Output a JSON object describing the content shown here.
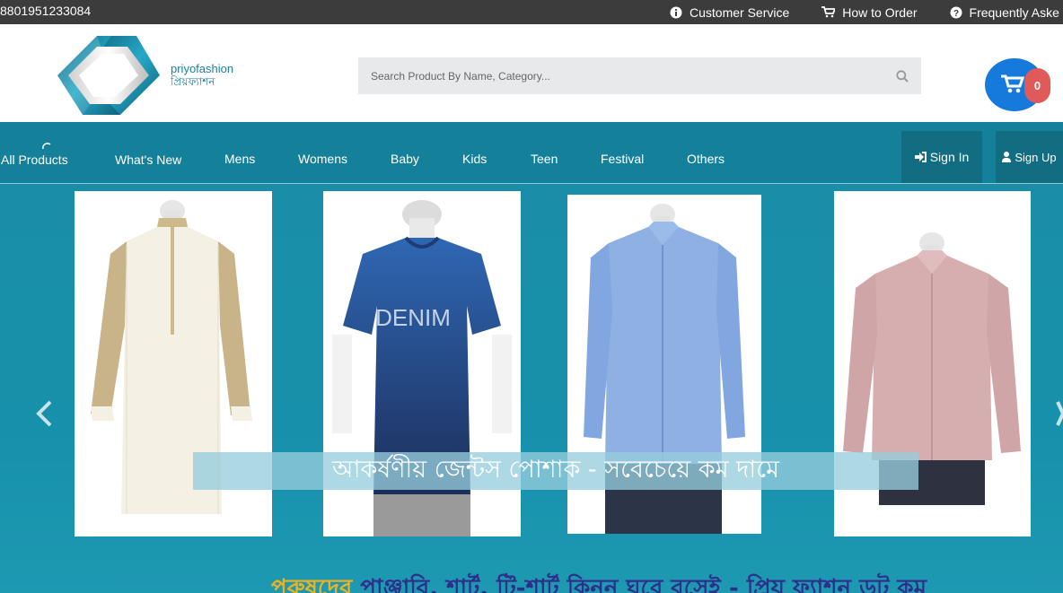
{
  "topbar": {
    "phone": "8801951233084",
    "links": [
      {
        "label": "Customer Service",
        "icon": "info-circle-icon"
      },
      {
        "label": "How to Order",
        "icon": "cart-icon"
      },
      {
        "label": "Frequently Aske",
        "icon": "question-circle-icon"
      }
    ]
  },
  "brand": {
    "name_en": "priyofashion",
    "name_bn": "প্রিয়ফ্যাশন",
    "logo_color": "#1a7fa0"
  },
  "search": {
    "placeholder": "Search Product By Name, Category...",
    "icon": "search-icon"
  },
  "cart": {
    "count": "0",
    "icon": "shopping-cart-icon",
    "accent": "#1679dc",
    "badge_color": "#e05a5a"
  },
  "nav": {
    "items": [
      "All Products",
      "What's New",
      "Mens",
      "Womens",
      "Baby",
      "Kids",
      "Teen",
      "Festival",
      "Others"
    ],
    "sign_in": "Sign In",
    "sign_up": "Sign Up",
    "bg_color": "#15809a"
  },
  "hero": {
    "caption": "আকর্ষণীয় জেন্টস পোশাক - সবেচেয়ে কম দামে",
    "tagline_highlight": "পুরুষদের",
    "tagline_rest": " পাঞ্জাবি, শার্ট, টি-শার্ট কিনুন ঘরে বসেই - প্রিয় ফ্যাশন ডট কম",
    "products": [
      "panjabi",
      "t-shirt",
      "blue-shirt",
      "pink-shirt"
    ]
  }
}
